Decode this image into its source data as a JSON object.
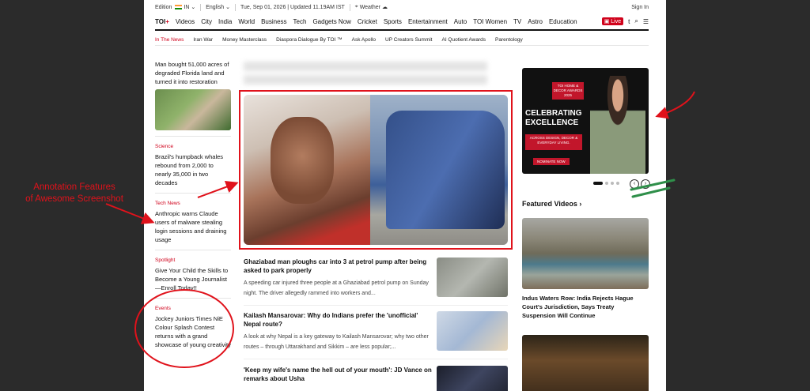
{
  "topbar": {
    "edition_label": "Edition",
    "edition_value": "IN",
    "language": "English",
    "date": "Tue, Sep 01, 2026 | Updated 11.19AM IST",
    "weather": "Weather",
    "signin": "Sign In"
  },
  "nav": {
    "logo": "TOI",
    "logo_plus": "+",
    "items": [
      "Videos",
      "City",
      "India",
      "World",
      "Business",
      "Tech",
      "Gadgets Now",
      "Cricket",
      "Sports",
      "Entertainment",
      "Auto",
      "TOI Women",
      "TV",
      "Astro",
      "Education",
      "t"
    ],
    "live": "Live"
  },
  "subnav": {
    "items": [
      "In The News",
      "Iran War",
      "Money Masterclass",
      "Diaspora Dialogue By TOI ™",
      "Ask Apollo",
      "UP Creators Summit",
      "AI Quotient Awards",
      "Parentology"
    ]
  },
  "left": {
    "story1": "Man bought 51,000 acres of degraded Florida land and turned it into restoration",
    "science_cat": "Science",
    "science": "Brazil's humpback whales rebound from 2,000 to nearly 35,000 in two decades",
    "tech_cat": "Tech News",
    "tech": "Anthropic warns Claude users of malware stealing login sessions and draining usage",
    "spot_cat": "Spotlight",
    "spot": "Give Your Child the Skills to Become a Young Journalist—Enroll Today!!",
    "events_cat": "Events",
    "events": "Jockey Juniors Times NiE Colour Splash Contest returns with a grand showcase of young creativity"
  },
  "center": {
    "s1_title": "Ghaziabad man ploughs car into 3 at petrol pump after being asked to park properly",
    "s1_desc": "A speeding car injured three people at a Ghaziabad petrol pump on Sunday night. The driver allegedly rammed into workers and...",
    "s2_title": "Kailash Mansarovar: Why do Indians prefer the 'unofficial' Nepal route?",
    "s2_desc": "A look at why Nepal is a key gateway to Kailash Mansarovar; why two other routes – through Uttarakhand and Sikkim – are less popular;...",
    "s3_title": "'Keep my wife's name the hell out of your mouth': JD Vance on remarks about Usha"
  },
  "ad": {
    "logo": "TOI HOME & DECOR AWARDS 2025",
    "headline": "CELEBRATING EXCELLENCE",
    "box": "ACROSS DESIGN, DECOR & EVERYDAY LIVING.",
    "button": "NOMINATE NOW"
  },
  "featured": {
    "heading": "Featured Videos",
    "v1_title": "Indus Waters Row: India Rejects Hague Court's Jurisdiction, Says Treaty Suspension Will Continue"
  },
  "annotation": {
    "line1": "Annotation Features",
    "line2": "of Awesome Screenshot"
  }
}
